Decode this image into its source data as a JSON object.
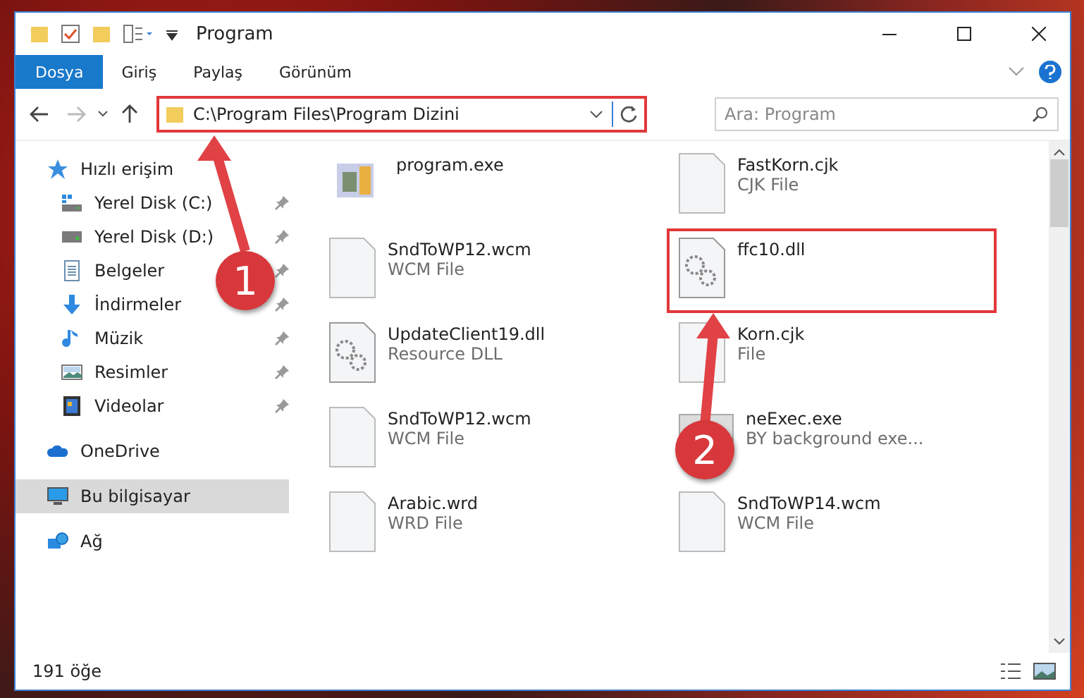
{
  "window": {
    "title": "Program"
  },
  "ribbon_tabs": [
    {
      "label": "Dosya",
      "selected": true
    },
    {
      "label": "Giriş",
      "selected": false
    },
    {
      "label": "Paylaş",
      "selected": false
    },
    {
      "label": "Görünüm",
      "selected": false
    }
  ],
  "address_bar": {
    "path": "C:\\Program Files\\Program Dizini",
    "highlighted": true
  },
  "search": {
    "placeholder": "Ara: Program"
  },
  "sidebar": {
    "items": [
      {
        "label": "Hızlı erişim",
        "kind": "star",
        "selected": false,
        "children": [
          {
            "label": "Yerel Disk (C:)",
            "kind": "drive-win",
            "pinned": true,
            "selected": false
          },
          {
            "label": "Yerel Disk (D:)",
            "kind": "drive",
            "pinned": true,
            "selected": false
          },
          {
            "label": "Belgeler",
            "kind": "document",
            "pinned": true,
            "selected": false
          },
          {
            "label": "İndirmeler",
            "kind": "download",
            "pinned": true,
            "selected": false
          },
          {
            "label": "Müzik",
            "kind": "music",
            "pinned": true,
            "selected": false
          },
          {
            "label": "Resimler",
            "kind": "picture",
            "pinned": true,
            "selected": false
          },
          {
            "label": "Videolar",
            "kind": "video",
            "pinned": true,
            "selected": false
          }
        ]
      },
      {
        "label": "OneDrive",
        "kind": "cloud",
        "selected": false
      },
      {
        "label": "Bu bilgisayar",
        "kind": "computer",
        "selected": true
      },
      {
        "label": "Ağ",
        "kind": "network",
        "selected": false
      }
    ]
  },
  "files": [
    {
      "name": "program.exe",
      "kind": "app",
      "highlighted": false
    },
    {
      "name": "FastKorn.cjk",
      "type": "CJK File",
      "kind": "blank",
      "highlighted": false
    },
    {
      "name": "SndToWP12.wcm",
      "type": "WCM File",
      "kind": "blank",
      "highlighted": false
    },
    {
      "name": "ffc10.dll",
      "kind": "dll",
      "highlighted": true
    },
    {
      "name": "UpdateClient19.dll",
      "type": "Resource DLL",
      "kind": "dll",
      "highlighted": false
    },
    {
      "name": "Korn.cjk",
      "type": "File",
      "kind": "blank",
      "highlighted": false
    },
    {
      "name": "SndToWP12.wcm",
      "type": "WCM File",
      "kind": "blank",
      "highlighted": false
    },
    {
      "name": "neExec.exe",
      "type": "BY background exe...",
      "kind": "window",
      "highlighted": false
    },
    {
      "name": "Arabic.wrd",
      "type": "WRD File",
      "kind": "blank",
      "highlighted": false
    },
    {
      "name": "SndToWP14.wcm",
      "type": "WCM File",
      "kind": "blank",
      "highlighted": false
    }
  ],
  "status_bar": {
    "item_count": "191 öğe"
  },
  "callouts": [
    {
      "number": "1"
    },
    {
      "number": "2"
    }
  ]
}
